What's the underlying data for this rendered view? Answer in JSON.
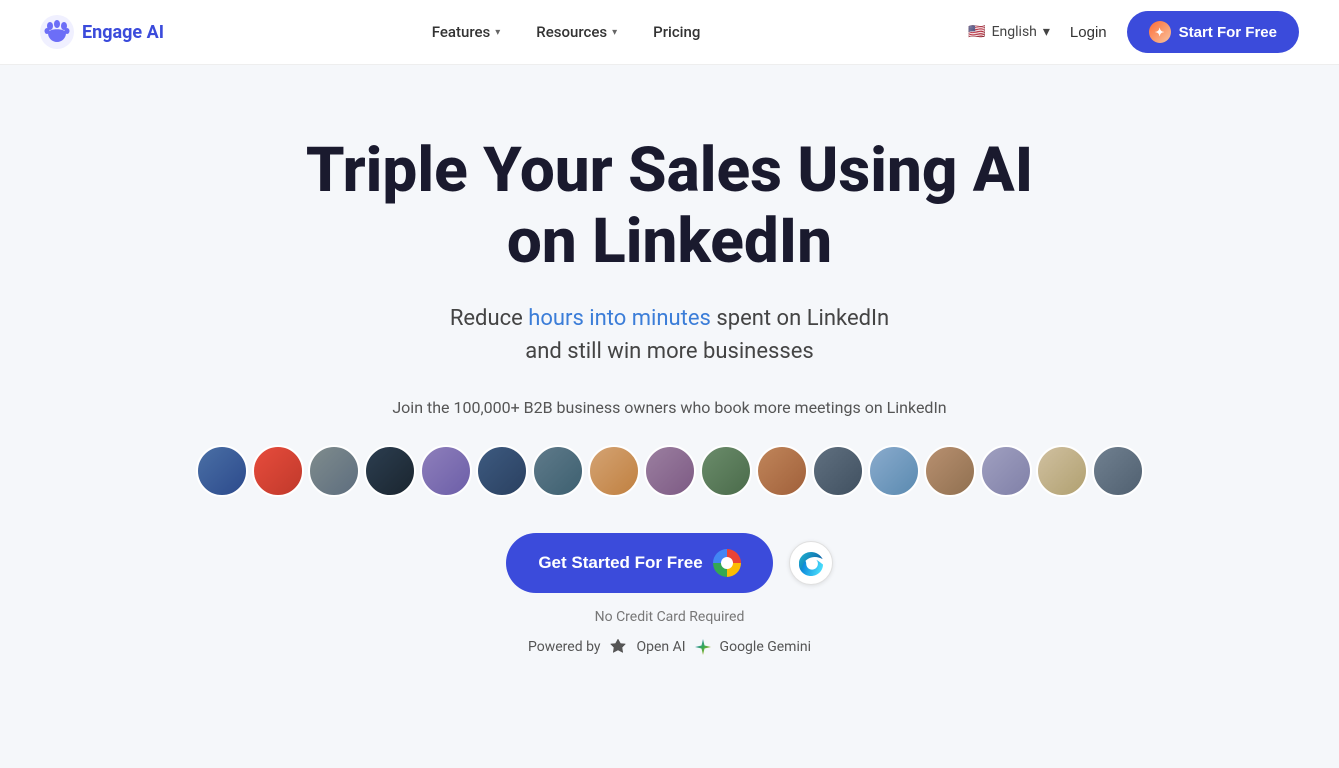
{
  "nav": {
    "logo_text": "Engage AI",
    "items": [
      {
        "label": "Features",
        "has_dropdown": true
      },
      {
        "label": "Resources",
        "has_dropdown": true
      },
      {
        "label": "Pricing",
        "has_dropdown": false
      }
    ],
    "language": "English",
    "login_label": "Login",
    "start_label": "Start For Free"
  },
  "hero": {
    "title_line1": "Triple Your Sales Using AI",
    "title_line2": "on LinkedIn",
    "subtitle_line1": "Reduce hours into minutes spent on LinkedIn",
    "subtitle_line2": "and still win more businesses",
    "highlight_word": "hours into minutes",
    "join_text": "Join the 100,000+ B2B business owners who book more meetings on LinkedIn",
    "cta_primary": "Get Started For Free",
    "no_cc_text": "No Credit Card Required",
    "powered_label": "Powered by",
    "openai_label": "Open AI",
    "gemini_label": "Google Gemini"
  },
  "avatars": [
    {
      "id": 1,
      "class": "av1",
      "initials": ""
    },
    {
      "id": 2,
      "class": "av2",
      "initials": ""
    },
    {
      "id": 3,
      "class": "av3",
      "initials": ""
    },
    {
      "id": 4,
      "class": "av4",
      "initials": ""
    },
    {
      "id": 5,
      "class": "av5",
      "initials": ""
    },
    {
      "id": 6,
      "class": "av6",
      "initials": ""
    },
    {
      "id": 7,
      "class": "av7",
      "initials": ""
    },
    {
      "id": 8,
      "class": "av8",
      "initials": ""
    },
    {
      "id": 9,
      "class": "av9",
      "initials": ""
    },
    {
      "id": 10,
      "class": "av10",
      "initials": ""
    },
    {
      "id": 11,
      "class": "av11",
      "initials": ""
    },
    {
      "id": 12,
      "class": "av12",
      "initials": ""
    },
    {
      "id": 13,
      "class": "av13",
      "initials": ""
    },
    {
      "id": 14,
      "class": "av14",
      "initials": ""
    },
    {
      "id": 15,
      "class": "av15",
      "initials": ""
    },
    {
      "id": 16,
      "class": "av16",
      "initials": ""
    },
    {
      "id": 17,
      "class": "av17",
      "initials": ""
    }
  ]
}
